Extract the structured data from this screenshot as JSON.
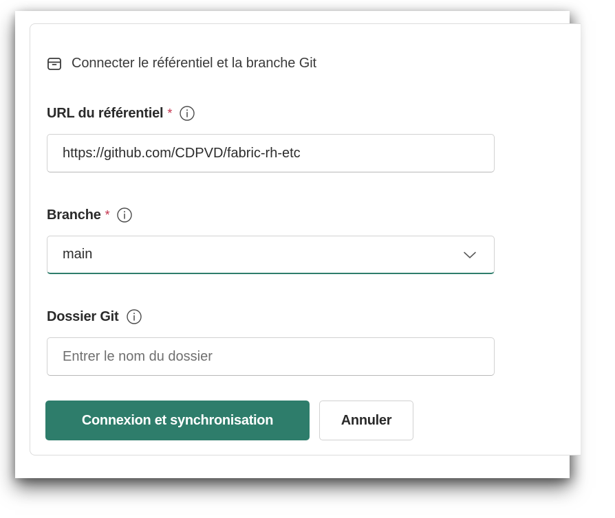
{
  "header": {
    "icon": "archive-box-icon",
    "title": "Connecter le référentiel et la branche Git"
  },
  "repo_url": {
    "label": "URL du référentiel",
    "required_mark": "*",
    "info_icon": "info-icon",
    "value": "https://github.com/CDPVD/fabric-rh-etc"
  },
  "branch": {
    "label": "Branche",
    "required_mark": "*",
    "info_icon": "info-icon",
    "value": "main",
    "dropdown_icon": "chevron-down-icon"
  },
  "git_folder": {
    "label": "Dossier Git",
    "info_icon": "info-icon",
    "value": "",
    "placeholder": "Entrer le nom du dossier"
  },
  "actions": {
    "primary_label": "Connexion et synchronisation",
    "secondary_label": "Annuler"
  },
  "colors": {
    "accent": "#2e7d6b",
    "required": "#c4314b"
  }
}
